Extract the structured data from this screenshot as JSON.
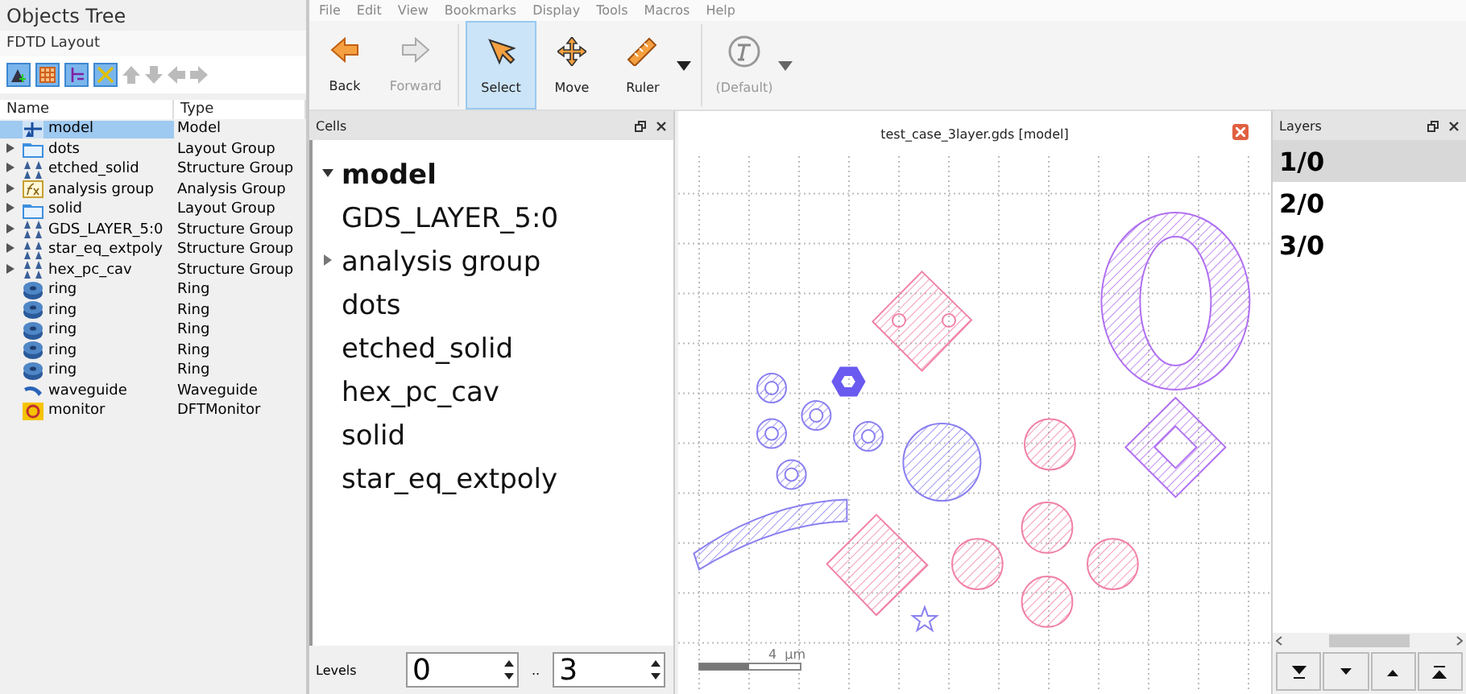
{
  "objects_panel": {
    "title": "Objects Tree",
    "subtitle": "FDTD Layout",
    "columns": [
      "Name",
      "Type"
    ],
    "rows": [
      {
        "kind": "model",
        "name": "model",
        "type": "Model",
        "expandable": false,
        "selected": true
      },
      {
        "kind": "layout-group",
        "name": "dots",
        "type": "Layout Group",
        "expandable": true,
        "selected": false
      },
      {
        "kind": "structure-group",
        "name": "etched_solid",
        "type": "Structure Group",
        "expandable": true,
        "selected": false
      },
      {
        "kind": "analysis-group",
        "name": "analysis group",
        "type": "Analysis Group",
        "expandable": true,
        "selected": false
      },
      {
        "kind": "layout-group",
        "name": "solid",
        "type": "Layout Group",
        "expandable": true,
        "selected": false
      },
      {
        "kind": "structure-group",
        "name": "GDS_LAYER_5:0",
        "type": "Structure Group",
        "expandable": true,
        "selected": false
      },
      {
        "kind": "structure-group",
        "name": "star_eq_extpoly",
        "type": "Structure Group",
        "expandable": true,
        "selected": false
      },
      {
        "kind": "structure-group",
        "name": "hex_pc_cav",
        "type": "Structure Group",
        "expandable": true,
        "selected": false
      },
      {
        "kind": "ring",
        "name": "ring",
        "type": "Ring",
        "expandable": false,
        "selected": false
      },
      {
        "kind": "ring",
        "name": "ring",
        "type": "Ring",
        "expandable": false,
        "selected": false
      },
      {
        "kind": "ring",
        "name": "ring",
        "type": "Ring",
        "expandable": false,
        "selected": false
      },
      {
        "kind": "ring",
        "name": "ring",
        "type": "Ring",
        "expandable": false,
        "selected": false
      },
      {
        "kind": "ring",
        "name": "ring",
        "type": "Ring",
        "expandable": false,
        "selected": false
      },
      {
        "kind": "waveguide",
        "name": "waveguide",
        "type": "Waveguide",
        "expandable": false,
        "selected": false
      },
      {
        "kind": "monitor",
        "name": "monitor",
        "type": "DFTMonitor",
        "expandable": false,
        "selected": false
      }
    ]
  },
  "menu": [
    "File",
    "Edit",
    "View",
    "Bookmarks",
    "Display",
    "Tools",
    "Macros",
    "Help"
  ],
  "toolbar": [
    {
      "kind": "back",
      "label": "Back",
      "selected": false,
      "disabled": false,
      "dropdown": false
    },
    {
      "kind": "forward",
      "label": "Forward",
      "selected": false,
      "disabled": true,
      "dropdown": false
    },
    {
      "kind": "select",
      "label": "Select",
      "selected": true,
      "disabled": false,
      "dropdown": false
    },
    {
      "kind": "move",
      "label": "Move",
      "selected": false,
      "disabled": false,
      "dropdown": false
    },
    {
      "kind": "ruler",
      "label": "Ruler",
      "selected": false,
      "disabled": false,
      "dropdown": true
    },
    {
      "kind": "text",
      "label": "(Default)",
      "selected": false,
      "disabled": true,
      "dropdown": true
    }
  ],
  "cells": {
    "title": "Cells",
    "tree": [
      {
        "label": "model",
        "expanded": true,
        "children": [
          {
            "label": "GDS_LAYER_5:0"
          },
          {
            "label": "analysis group",
            "expanded": false
          },
          {
            "label": "dots"
          },
          {
            "label": "etched_solid"
          },
          {
            "label": "hex_pc_cav"
          },
          {
            "label": "solid"
          },
          {
            "label": "star_eq_extpoly"
          }
        ]
      }
    ],
    "levels_label": "Levels",
    "level_from": "0",
    "separator": "..",
    "level_to": "3"
  },
  "canvas": {
    "title": "test_case_3layer.gds [model]",
    "scale_label": "4  µm"
  },
  "layers": {
    "title": "Layers",
    "items": [
      {
        "label": "1/0",
        "selected": true
      },
      {
        "label": "2/0",
        "selected": false
      },
      {
        "label": "3/0",
        "selected": false
      }
    ]
  }
}
